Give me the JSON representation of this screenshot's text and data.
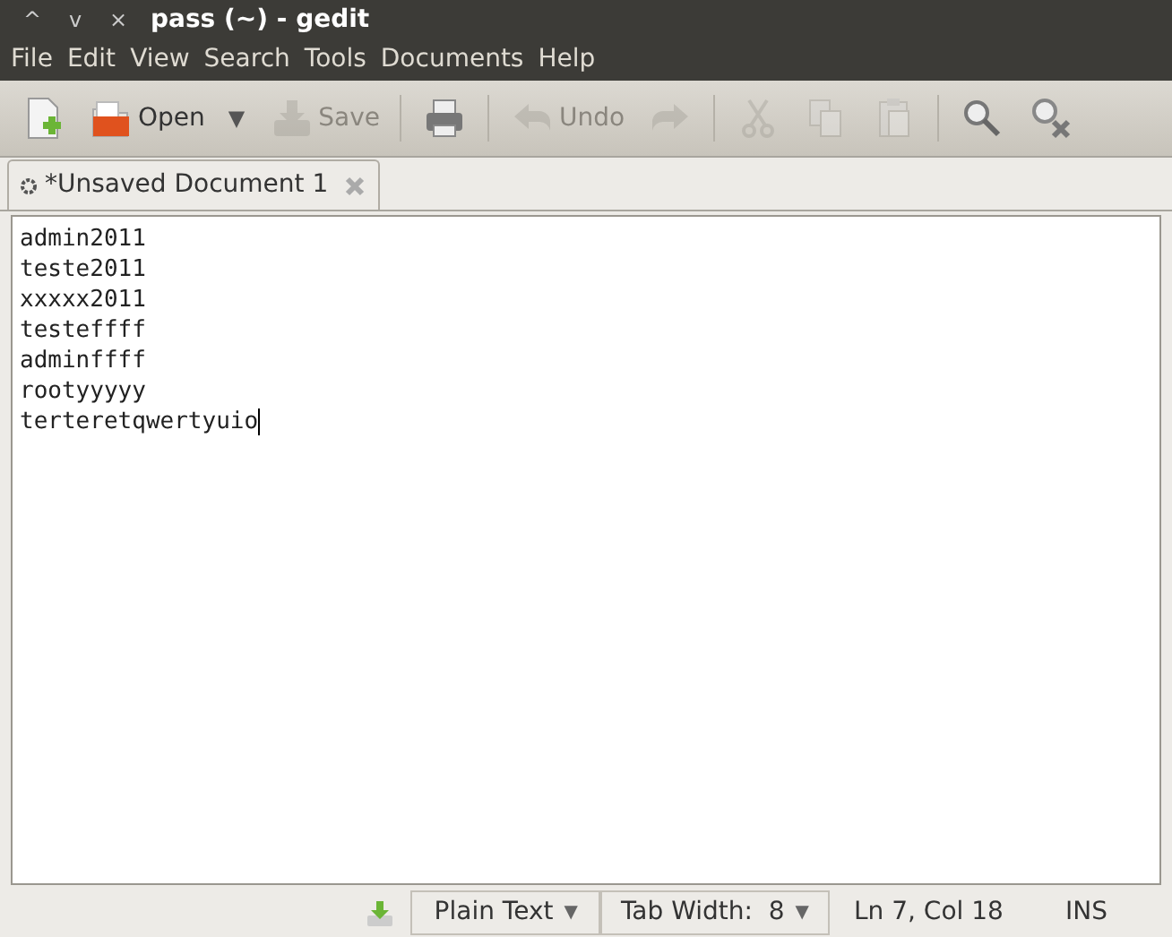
{
  "window": {
    "title": "pass (~) - gedit",
    "controls": [
      "^",
      "v",
      "×"
    ]
  },
  "menu": [
    "File",
    "Edit",
    "View",
    "Search",
    "Tools",
    "Documents",
    "Help"
  ],
  "toolbar": [
    {
      "kind": "new",
      "disabled": false
    },
    {
      "kind": "open",
      "label": "Open",
      "disabled": false
    },
    {
      "kind": "dropdown",
      "label": "▼",
      "disabled": false
    },
    {
      "kind": "save",
      "label": "Save",
      "disabled": true
    },
    {
      "kind": "separator"
    },
    {
      "kind": "print",
      "disabled": false
    },
    {
      "kind": "separator"
    },
    {
      "kind": "undo",
      "label": "Undo",
      "disabled": true
    },
    {
      "kind": "redo",
      "disabled": true
    },
    {
      "kind": "separator"
    },
    {
      "kind": "cut",
      "disabled": true
    },
    {
      "kind": "copy",
      "disabled": true
    },
    {
      "kind": "paste",
      "disabled": true
    },
    {
      "kind": "separator"
    },
    {
      "kind": "find",
      "disabled": false
    },
    {
      "kind": "replace",
      "disabled": false
    }
  ],
  "tabs": [
    {
      "label": "*Unsaved Document 1",
      "selected": true
    }
  ],
  "editor": {
    "lines": [
      "admin2011",
      "teste2011",
      "xxxxx2011",
      "testeffff",
      "adminffff",
      "rootyyyyy",
      "terteretqwertyuio"
    ]
  },
  "status_bar": {
    "language": "Plain Text",
    "language_arrow": "▼",
    "tab_width": "Tab Width:  8",
    "tab_width_arrow": "▼",
    "position": "Ln 7, Col 18",
    "mode": "INS"
  }
}
